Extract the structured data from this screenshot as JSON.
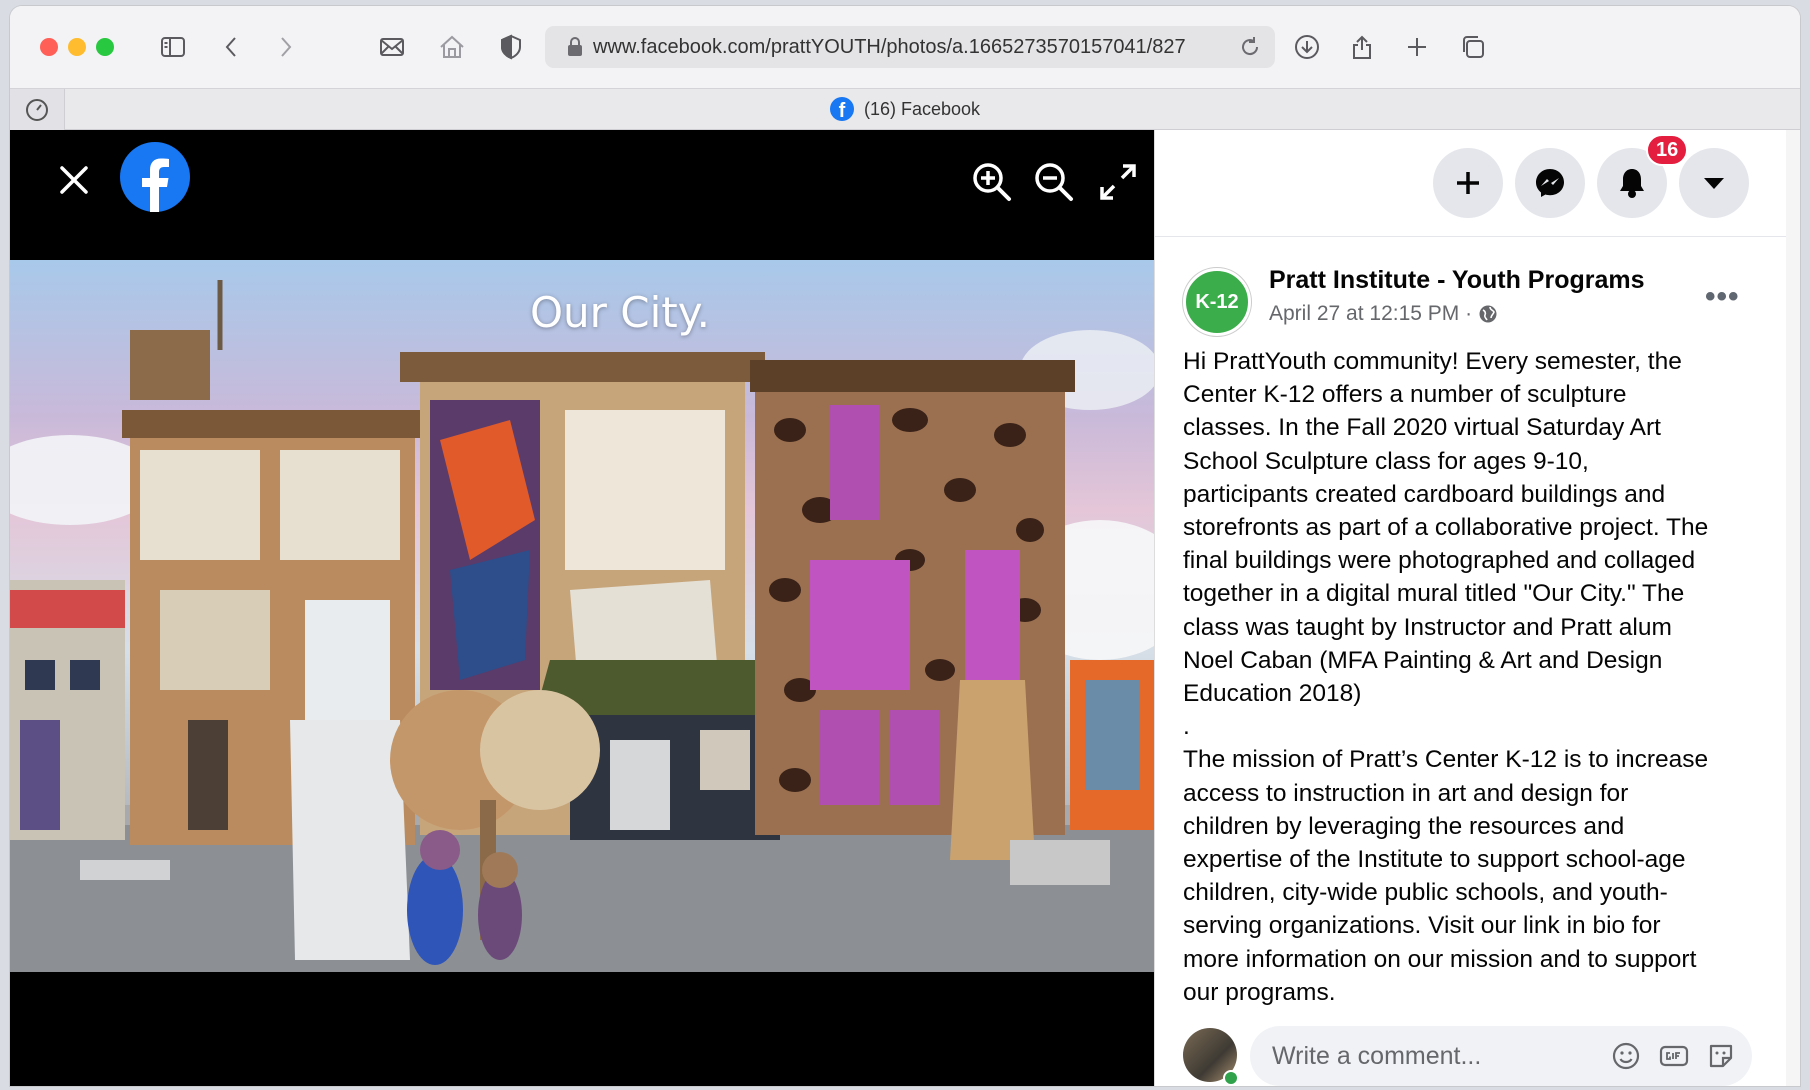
{
  "browser": {
    "url": "www.facebook.com/prattYOUTH/photos/a.1665273570157041/827",
    "tab_title": "(16) Facebook"
  },
  "photo": {
    "title": "Our City."
  },
  "header": {
    "notification_count": "16"
  },
  "post": {
    "page_avatar_text": "K-12",
    "page_name": "Pratt Institute - Youth Programs",
    "timestamp": "April 27 at 12:15 PM ·",
    "more": "•••",
    "body": "Hi PrattYouth community! Every semester, the\nCenter K-12 offers a number of sculpture\nclasses. In the Fall 2020 virtual Saturday Art\nSchool Sculpture class for ages 9-10,\nparticipants created cardboard buildings and\nstorefronts as part of a collaborative project. The\nfinal buildings were photographed and collaged\ntogether in a digital mural titled \"Our City.\" The\nclass was taught by Instructor and Pratt alum\nNoel Caban (MFA Painting & Art and Design\nEducation 2018)\n.\nThe mission of Pratt’s Center K-12 is to increase\naccess to instruction in art and design for\nchildren by leveraging the resources and\nexpertise of the Institute to support school-age\nchildren, city-wide public schools, and youth-\nserving organizations. Visit our link in bio for\nmore information on our mission and to support\nour programs."
  },
  "comment": {
    "placeholder": "Write a comment..."
  },
  "colors": {
    "facebook_blue": "#1877f2",
    "badge_red": "#e41e3f",
    "k12_green": "#3cad4b"
  }
}
